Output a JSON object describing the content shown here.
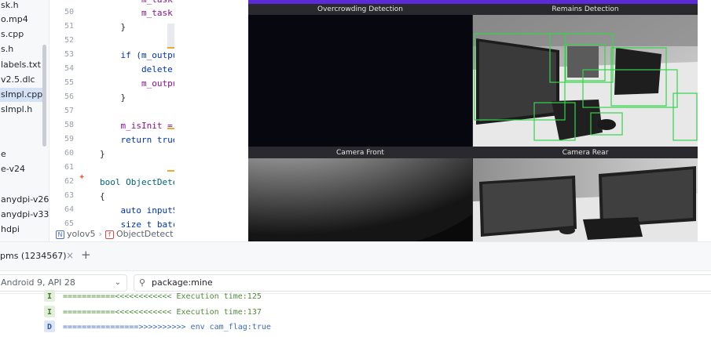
{
  "project_tree": {
    "items": [
      {
        "label": "sk.h",
        "selected": false
      },
      {
        "label": "o.mp4",
        "selected": false
      },
      {
        "label": "s.cpp",
        "selected": false
      },
      {
        "label": "s.h",
        "selected": false
      },
      {
        "label": "labels.txt",
        "selected": false
      },
      {
        "label": "v2.5.dlc",
        "selected": false
      },
      {
        "label": "sImpl.cpp",
        "selected": true
      },
      {
        "label": "sImpl.h",
        "selected": false
      },
      {
        "label": "",
        "selected": false
      },
      {
        "label": "",
        "selected": false
      },
      {
        "label": "e",
        "selected": false
      },
      {
        "label": "e-v24",
        "selected": false
      },
      {
        "label": "",
        "selected": false
      },
      {
        "label": "anydpi-v26",
        "selected": false
      },
      {
        "label": "anydpi-v33",
        "selected": false
      },
      {
        "label": "hdpi",
        "selected": false
      }
    ]
  },
  "editor": {
    "line_numbers": [
      "50",
      "51",
      "52",
      "53",
      "54",
      "55",
      "56",
      "57",
      "58",
      "59",
      "60",
      "61",
      "62",
      "63",
      "64",
      "65"
    ],
    "lines": [
      "        m_task",
      "        m_task.",
      "    }",
      "",
      "    if (m_outpu",
      "        delete[",
      "        m_outpu",
      "    }",
      "",
      "    m_isInit =",
      "    return true",
      "}",
      "",
      "bool ObjectDete",
      "{",
      "    auto inputS",
      "    size_t batc"
    ],
    "breadcrumb": {
      "module_badge": "N",
      "module": "yolov5",
      "symbol_badge": "f",
      "symbol": "ObjectDetect"
    }
  },
  "video": {
    "panes": [
      {
        "title": "Overcrowding Detection"
      },
      {
        "title": "Remains Detection"
      },
      {
        "title": "Camera Front"
      },
      {
        "title": "Camera Rear"
      }
    ]
  },
  "logcat": {
    "tab_label": "pms (1234567)",
    "close_glyph": "×",
    "add_glyph": "+",
    "device": "Android 9, API 28",
    "filter_icon": "filter-icon",
    "filter_value": "package:mine",
    "rows": [
      {
        "level": "I",
        "message": "===========<<<<<<<<<<<< Execution time:125"
      },
      {
        "level": "I",
        "message": "===========<<<<<<<<<<<< Execution time:137"
      },
      {
        "level": "D",
        "message": "================>>>>>>>>>> env cam_flag:true"
      }
    ]
  },
  "colors": {
    "video_top_bar": "#5a2bd6",
    "detection_box": "#35d44a",
    "selection": "#d5e1f5"
  }
}
